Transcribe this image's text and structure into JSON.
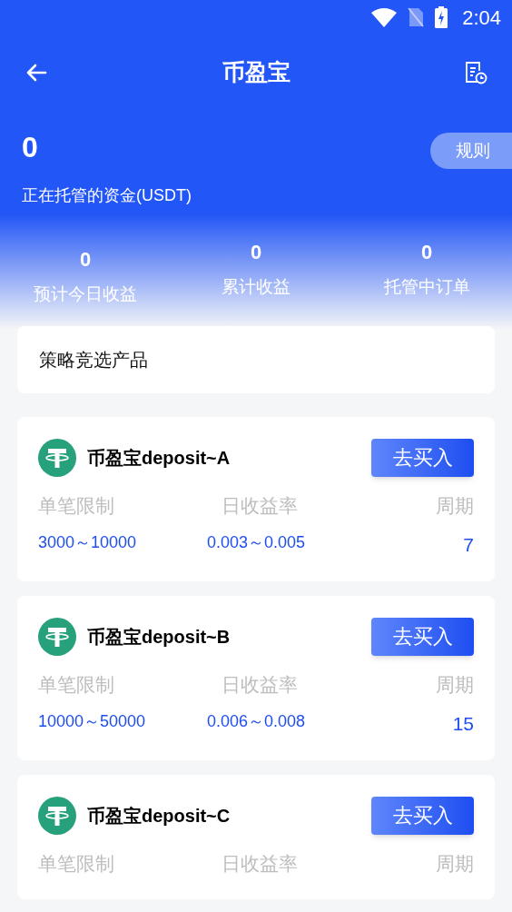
{
  "status_bar": {
    "time": "2:04"
  },
  "header": {
    "title": "币盈宝"
  },
  "summary": {
    "amount": "0",
    "amount_label": "正在托管的资金(USDT)",
    "rules_button": "规则",
    "stats": [
      {
        "value": "0",
        "label": "预计今日收益"
      },
      {
        "value": "0",
        "label": "累计收益"
      },
      {
        "value": "0",
        "label": "托管中订单"
      }
    ]
  },
  "section_title": "策略竞选产品",
  "products": [
    {
      "name": "币盈宝deposit~A",
      "button": "去买入",
      "columns": [
        "单笔限制",
        "日收益率",
        "周期"
      ],
      "values": [
        "3000～10000",
        "0.003～0.005",
        "7"
      ]
    },
    {
      "name": "币盈宝deposit~B",
      "button": "去买入",
      "columns": [
        "单笔限制",
        "日收益率",
        "周期"
      ],
      "values": [
        "10000～50000",
        "0.006～0.008",
        "15"
      ]
    },
    {
      "name": "币盈宝deposit~C",
      "button": "去买入",
      "columns": [
        "单笔限制",
        "日收益率",
        "周期"
      ]
    }
  ]
}
